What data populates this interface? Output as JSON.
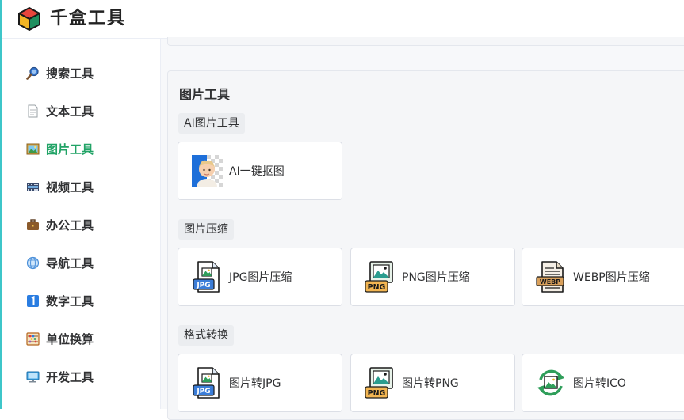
{
  "app": {
    "title": "千盒工具"
  },
  "sidebar": {
    "items": [
      {
        "label": "搜索工具",
        "icon": "magnifier-icon",
        "active": false
      },
      {
        "label": "文本工具",
        "icon": "document-icon",
        "active": false
      },
      {
        "label": "图片工具",
        "icon": "picture-icon",
        "active": true
      },
      {
        "label": "视频工具",
        "icon": "film-icon",
        "active": false
      },
      {
        "label": "办公工具",
        "icon": "briefcase-icon",
        "active": false
      },
      {
        "label": "导航工具",
        "icon": "globe-icon",
        "active": false
      },
      {
        "label": "数字工具",
        "icon": "number-one-icon",
        "active": false
      },
      {
        "label": "单位换算",
        "icon": "abacus-icon",
        "active": false
      },
      {
        "label": "开发工具",
        "icon": "monitor-icon",
        "active": false
      }
    ]
  },
  "main": {
    "section_title": "图片工具",
    "groups": [
      {
        "label": "AI图片工具",
        "cards": [
          {
            "label": "AI一键抠图",
            "icon": "portrait-cutout-icon"
          }
        ]
      },
      {
        "label": "图片压缩",
        "cards": [
          {
            "label": "JPG图片压缩",
            "icon": "jpg-file-icon"
          },
          {
            "label": "PNG图片压缩",
            "icon": "png-file-icon"
          },
          {
            "label": "WEBP图片压缩",
            "icon": "webp-file-icon"
          }
        ]
      },
      {
        "label": "格式转换",
        "cards": [
          {
            "label": "图片转JPG",
            "icon": "jpg-file-icon"
          },
          {
            "label": "图片转PNG",
            "icon": "png-file-icon"
          },
          {
            "label": "图片转ICO",
            "icon": "image-convert-icon"
          }
        ]
      }
    ]
  },
  "file_badges": {
    "jpg": "JPG",
    "png": "PNG",
    "webp": "WEBP"
  },
  "colors": {
    "accent": "#21a366",
    "left_edge": "#3ec6c9"
  }
}
